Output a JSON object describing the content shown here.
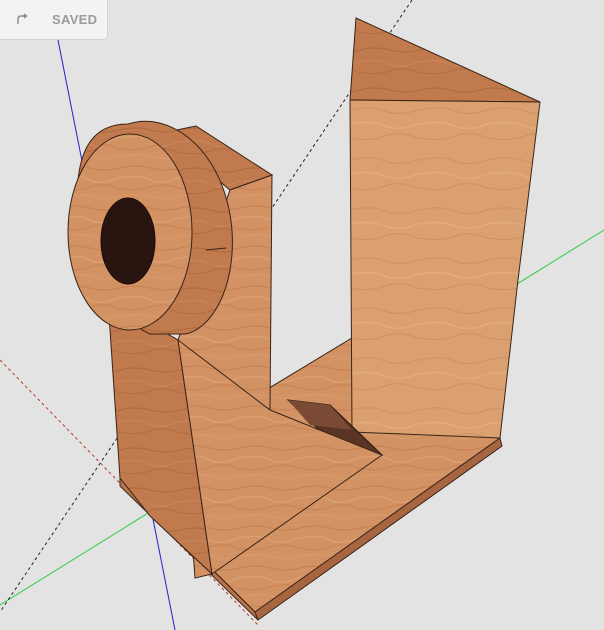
{
  "toolbar": {
    "redo_icon": "redo-icon",
    "status_label": "SAVED"
  },
  "scene": {
    "description_colors": {
      "background": "#e3e3e3",
      "wood_light": "#d99a6c",
      "wood_mid": "#c88458",
      "wood_dark": "#a8643c",
      "hole": "#2a1410",
      "axis_red": "#c0392b",
      "axis_green": "#2ecc40",
      "axis_blue": "#2222cc"
    }
  }
}
